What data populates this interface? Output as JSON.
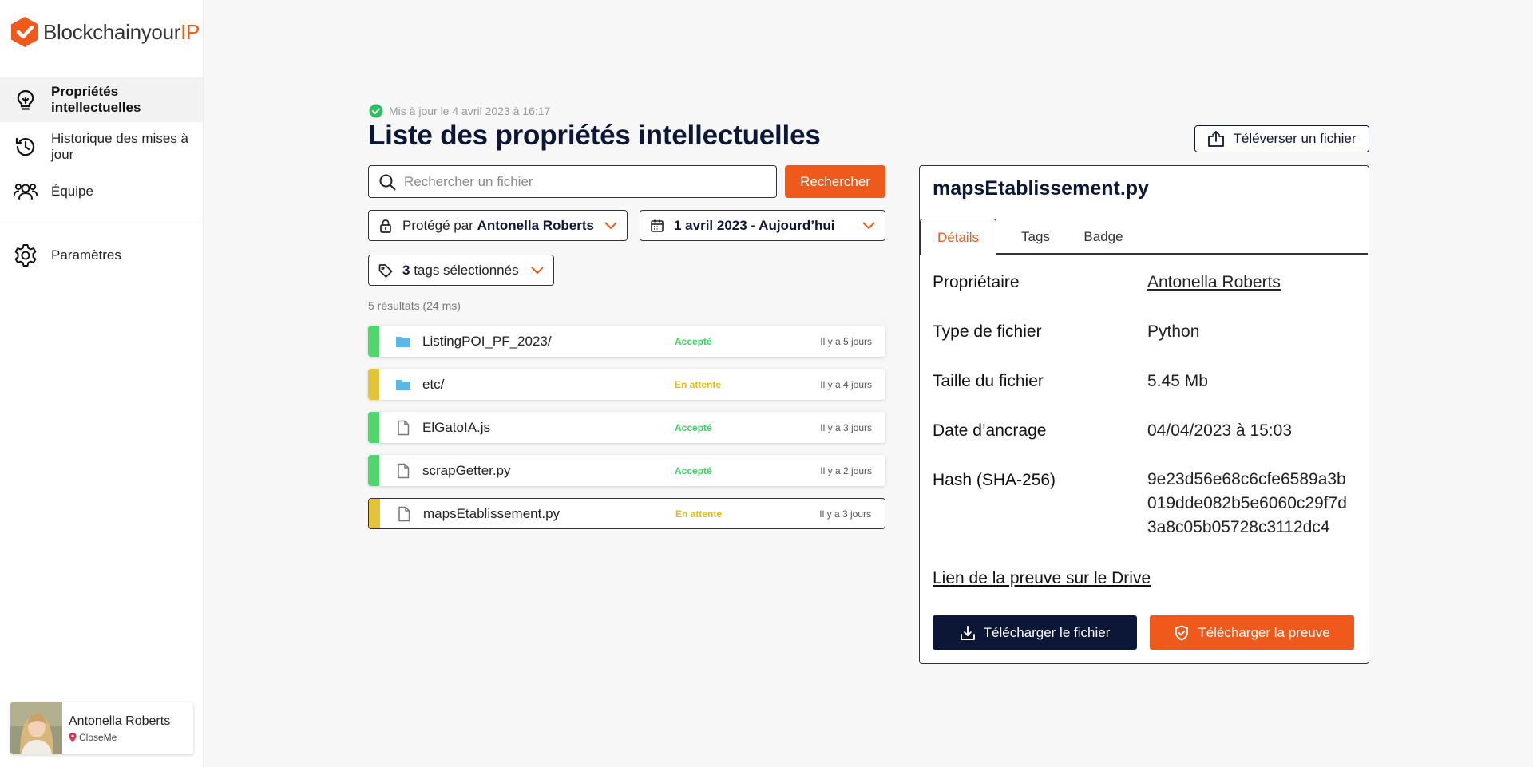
{
  "brand": {
    "name_main": "Blockchainyour",
    "name_accent": "IP",
    "accent_color": "#ef5a1c",
    "navy": "#0c1637"
  },
  "sidebar": {
    "items": [
      {
        "label": "Propriétés intellectuelles",
        "icon": "lightbulb-icon",
        "active": true
      },
      {
        "label": "Historique des mises à jour",
        "icon": "history-icon",
        "active": false
      },
      {
        "label": "Équipe",
        "icon": "team-icon",
        "active": false
      },
      {
        "label": "Paramètres",
        "icon": "gear-icon",
        "active": false
      }
    ],
    "user": {
      "name": "Antonella Roberts",
      "org": "CloseMe"
    }
  },
  "header": {
    "updated": "Mis à jour le 4 avril 2023 à 16:17",
    "title": "Liste des propriétés intellectuelles",
    "upload_label": "Téléverser un fichier"
  },
  "search": {
    "placeholder": "Rechercher un fichier",
    "button_label": "Rechercher"
  },
  "filters": {
    "owner_prefix": "Protégé par",
    "owner_value": "Antonella Roberts",
    "date_range": "1 avril 2023 - Aujourd’hui",
    "tags_count": "3",
    "tags_label": "tags sélectionnés"
  },
  "results": {
    "summary": "5 résultats (24 ms)",
    "rows": [
      {
        "name": "ListingPOI_PF_2023/",
        "type": "folder",
        "status": "Accepté",
        "status_color": "#3fd061",
        "date": "Il y a 5 jours"
      },
      {
        "name": "etc/",
        "type": "folder",
        "status": "En attente",
        "status_color": "#e3c33a",
        "date": "Il y a 4 jours"
      },
      {
        "name": "ElGatoIA.js",
        "type": "file",
        "status": "Accepté",
        "status_color": "#3fd061",
        "date": "Il y a 3 jours"
      },
      {
        "name": "scrapGetter.py",
        "type": "file",
        "status": "Accepté",
        "status_color": "#3fd061",
        "date": "Il y a 2 jours"
      },
      {
        "name": "mapsEtablissement.py",
        "type": "file",
        "status": "En attente",
        "status_color": "#e3c33a",
        "date": "Il y a 3 jours"
      }
    ]
  },
  "detail": {
    "title": "mapsEtablissement.py",
    "tabs": [
      "Détails",
      "Tags",
      "Badge"
    ],
    "fields": {
      "owner_label": "Propriétaire",
      "owner_value": "Antonella Roberts",
      "type_label": "Type de fichier",
      "type_value": "Python",
      "size_label": "Taille du fichier",
      "size_value": "5.45 Mb",
      "date_label": "Date d’ancrage",
      "date_value": "04/04/2023 à 15:03",
      "hash_label": "Hash (SHA-256)",
      "hash_value": "9e23d56e68c6cfe6589a3b019dde082b5e6060c29f7d3a8c05b05728c3112dc4"
    },
    "proof_link": "Lien de la preuve sur le Drive",
    "download_file": "Télécharger le fichier",
    "download_proof": "Télécharger la preuve"
  }
}
